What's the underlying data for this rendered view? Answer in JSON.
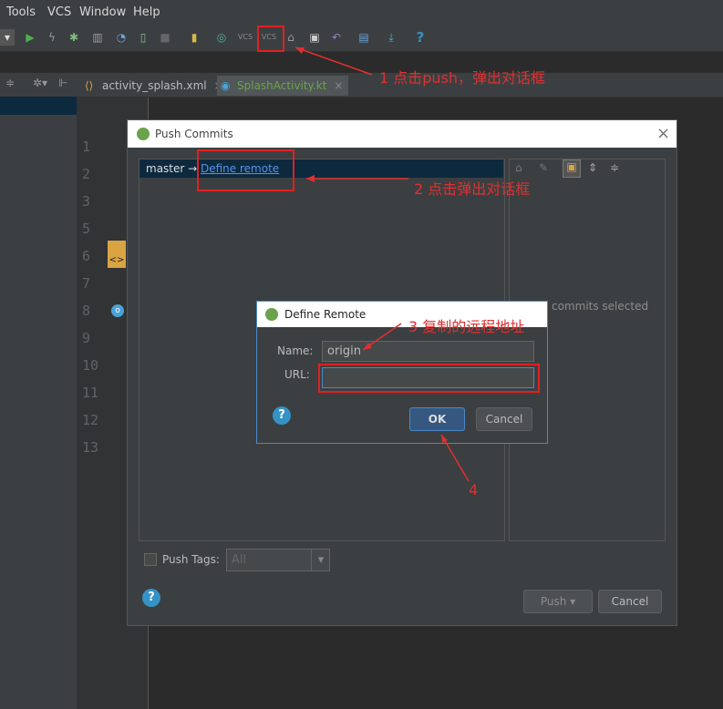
{
  "menu": [
    "Tools",
    "VCS",
    "Window",
    "Help"
  ],
  "toolbar_icons": [
    "run-icon",
    "lightning-icon",
    "debug-icon",
    "coverage-icon",
    "profile-icon",
    "attach-icon",
    "stop-icon",
    "device-icon",
    "sync-icon",
    "vcs-update-icon",
    "vcs-push-icon",
    "history-icon",
    "sdk-icon",
    "revert-icon",
    "structure-icon",
    "avd-icon",
    "help-icon"
  ],
  "vcs_label": "VCS",
  "editor_tabs": [
    {
      "label": "activity_splash.xml",
      "close": "×"
    },
    {
      "label": "SplashActivity.kt",
      "close": "×"
    }
  ],
  "line_numbers": [
    "1",
    "2",
    "3",
    "5",
    "6",
    "7",
    "8",
    "9",
    "10",
    "11",
    "12",
    "13"
  ],
  "push_dialog": {
    "title": "Push Commits",
    "close": "×",
    "branch": "master →",
    "define_remote_link": "Define remote",
    "no_commits": "commits selected",
    "push_tags_label": "Push Tags:",
    "push_tags_value": "All",
    "push_button": "Push ▾",
    "cancel_button": "Cancel",
    "help": "?"
  },
  "define_remote": {
    "title": "Define Remote",
    "name_label": "Name:",
    "name_value": "origin",
    "url_label": "URL:",
    "url_value": "",
    "ok_button": "OK",
    "cancel_button": "Cancel",
    "help": "?"
  },
  "annotations": {
    "a1": "1 点击push，弹出对话框",
    "a2": "2 点击弹出对话框",
    "a3": "3 复制的远程地址",
    "a4": "4"
  },
  "colors": {
    "annotation": "#e03030",
    "link": "#5394ec",
    "selection": "#0d293e",
    "help": "#3592c4"
  }
}
